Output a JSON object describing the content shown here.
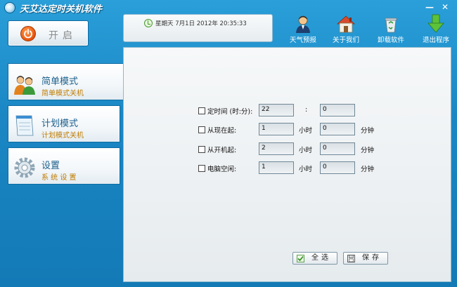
{
  "window": {
    "title": "天艾达定时关机软件",
    "minimize_glyph": "—",
    "close_glyph": "✕"
  },
  "start_button": {
    "label": "开启",
    "icon": "power-icon"
  },
  "datetime": {
    "text": "星期天 7月1日 2012年 20:35:33",
    "icon": "clock-icon"
  },
  "toolbar": {
    "items": [
      {
        "label": "天气预报",
        "icon": "weather-person-icon"
      },
      {
        "label": "关于我们",
        "icon": "home-icon"
      },
      {
        "label": "卸载软件",
        "icon": "recycle-bin-icon"
      },
      {
        "label": "退出程序",
        "icon": "down-arrow-icon"
      }
    ]
  },
  "sidebar": {
    "items": [
      {
        "title": "简单模式",
        "subtitle": "简单模式关机",
        "icon": "users-icon",
        "active": true
      },
      {
        "title": "计划模式",
        "subtitle": "计划模式关机",
        "icon": "notepad-icon",
        "active": false
      },
      {
        "title": "设置",
        "subtitle": "系 统 设 置",
        "icon": "gear-icon",
        "active": false
      }
    ]
  },
  "form": {
    "rows": [
      {
        "label": "定时间 (时:分):",
        "first_value": "22",
        "separator": ":",
        "second_value": "0",
        "first_unit": "",
        "second_unit": ""
      },
      {
        "label": "从现在起:",
        "first_value": "1",
        "separator": "",
        "second_value": "0",
        "first_unit": "小时",
        "second_unit": "分钟"
      },
      {
        "label": "从开机起:",
        "first_value": "2",
        "separator": "",
        "second_value": "0",
        "first_unit": "小时",
        "second_unit": "分钟"
      },
      {
        "label": "电脑空闲:",
        "first_value": "1",
        "separator": "",
        "second_value": "0",
        "first_unit": "小时",
        "second_unit": "分钟"
      }
    ]
  },
  "buttons": {
    "select_all": "全选",
    "save": "保存"
  },
  "colors": {
    "background": "#1a87c4",
    "accent_text": "#c07b00",
    "title_text": "#1c5f8c",
    "power": "#e8530d"
  }
}
